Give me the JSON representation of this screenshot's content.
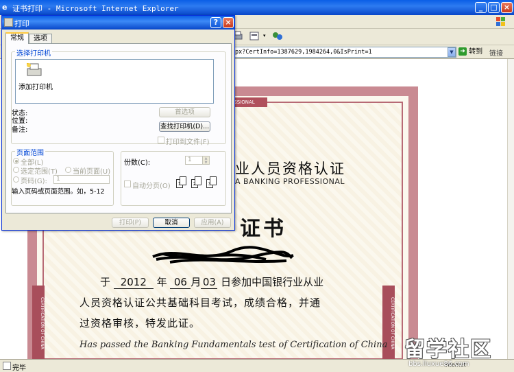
{
  "window": {
    "title": "证书打印 - Microsoft Internet Explorer",
    "minimize": "_",
    "maximize": "□",
    "close": "×"
  },
  "address": {
    "url": "px?CertInfo=1387629,1984264,0&IsPrint=1",
    "go_label": "转到",
    "links_label": "链接"
  },
  "status": {
    "text": "完毕",
    "zone": "Internet"
  },
  "certificate": {
    "band_text": "PROFESSIONAL",
    "heading_cn": "业人员资格认证",
    "heading_en": "A BANKING PROFESSIONAL",
    "big_title": "证书",
    "line1": {
      "prefix": "于",
      "year": "2012",
      "year_unit": "年",
      "month": "06",
      "month_unit": "月",
      "day": "03",
      "suffix": "日参加中国银行业从业"
    },
    "line2": "人员资格认证公共基础科目考试，成绩合格，并通",
    "line3": "过资格审核，特发此证。",
    "line_en": "Has passed the Banking Fundamentals test of Certification of China",
    "side_text": "CERTIFICATION OF CHINA"
  },
  "watermark": {
    "logo": "留学社区",
    "url": "bbs.liuxue86.com"
  },
  "dialog": {
    "title": "打印",
    "help": "?",
    "close": "×",
    "tabs": [
      "常规",
      "选项"
    ],
    "printer_group_label": "选择打印机",
    "add_printer": "添加打印机",
    "status_label": "状态:",
    "location_label": "位置:",
    "comment_label": "备注:",
    "preferences_button": "首选项",
    "find_printer_button": "查找打印机(D)...",
    "print_to_file": "打印到文件(F)",
    "range_group_label": "页面范围",
    "range_all": "全部(L)",
    "range_selection": "选定范围(T)",
    "range_current": "当前页面(U)",
    "range_pages": "页码(G):",
    "pages_value": "1",
    "range_hint": "输入页码或页面范围。如，5-12",
    "copies_label": "份数(C):",
    "copies_value": "1",
    "collate_label": "自动分页(O)",
    "print_button": "打印(P)",
    "cancel_button": "取消",
    "apply_button": "应用(A)"
  }
}
